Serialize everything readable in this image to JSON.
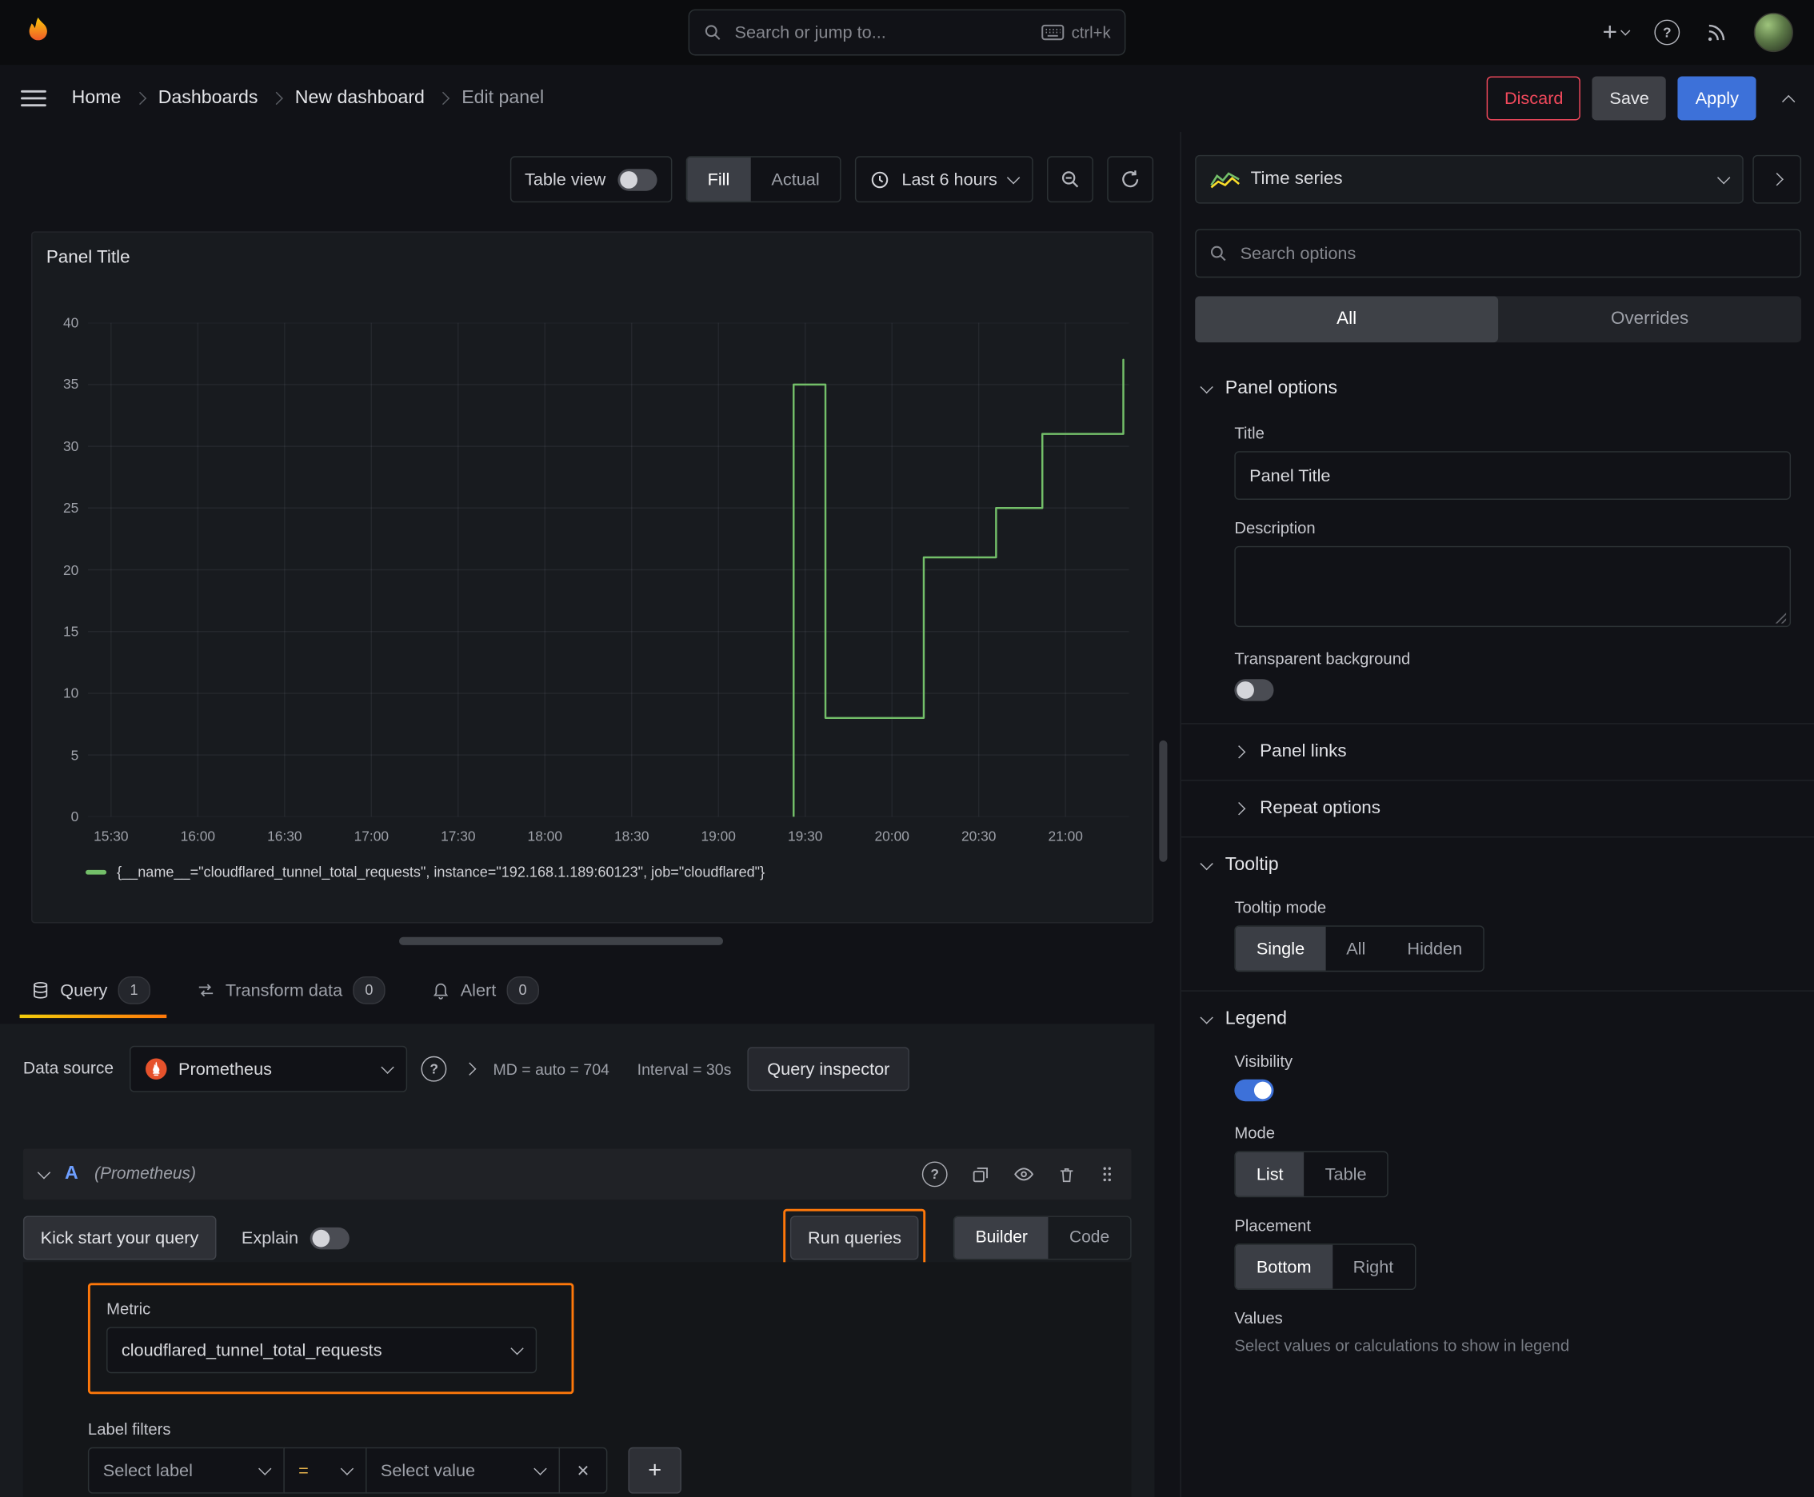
{
  "topbar": {
    "search_placeholder": "Search or jump to...",
    "search_shortcut": "ctrl+k"
  },
  "breadcrumbs": [
    "Home",
    "Dashboards",
    "New dashboard",
    "Edit panel"
  ],
  "actions": {
    "discard": "Discard",
    "save": "Save",
    "apply": "Apply"
  },
  "toolbar": {
    "table_view": "Table view",
    "fill": "Fill",
    "actual": "Actual",
    "time_range": "Last 6 hours"
  },
  "panel": {
    "title": "Panel Title"
  },
  "chart_data": {
    "type": "line",
    "line_style": "step",
    "title": "Panel Title",
    "x_ticks": [
      "15:30",
      "16:00",
      "16:30",
      "17:00",
      "17:30",
      "18:00",
      "18:30",
      "19:00",
      "19:30",
      "20:00",
      "20:30",
      "21:00"
    ],
    "y_ticks": [
      0,
      5,
      10,
      15,
      20,
      25,
      30,
      35,
      40
    ],
    "ylim": [
      0,
      40
    ],
    "x_domain": [
      "15:22",
      "21:22"
    ],
    "grid": true,
    "legend_position": "bottom",
    "series": [
      {
        "name": "{__name__=\"cloudflared_tunnel_total_requests\", instance=\"192.168.1.189:60123\", job=\"cloudflared\"}",
        "color": "#73bf69",
        "points": [
          {
            "time": "19:26",
            "value": 0
          },
          {
            "time": "19:26",
            "value": 35
          },
          {
            "time": "19:37",
            "value": 35
          },
          {
            "time": "19:37",
            "value": 8
          },
          {
            "time": "20:11",
            "value": 8
          },
          {
            "time": "20:11",
            "value": 21
          },
          {
            "time": "20:36",
            "value": 21
          },
          {
            "time": "20:36",
            "value": 25
          },
          {
            "time": "20:52",
            "value": 25
          },
          {
            "time": "20:52",
            "value": 31
          },
          {
            "time": "21:20",
            "value": 31
          },
          {
            "time": "21:20",
            "value": 37
          }
        ]
      }
    ]
  },
  "tabs": {
    "query": "Query",
    "query_badge": "1",
    "transform": "Transform data",
    "transform_badge": "0",
    "alert": "Alert",
    "alert_badge": "0"
  },
  "query": {
    "datasource_label": "Data source",
    "datasource_name": "Prometheus",
    "max_data_points": "MD = auto = 704",
    "interval": "Interval = 30s",
    "query_inspector": "Query inspector",
    "ref_id": "A",
    "ref_hint": "(Prometheus)",
    "kick_start": "Kick start your query",
    "explain": "Explain",
    "run_queries": "Run queries",
    "builder": "Builder",
    "code": "Code",
    "metric_label": "Metric",
    "metric_value": "cloudflared_tunnel_total_requests",
    "label_filters": "Label filters",
    "select_label": "Select label",
    "operator": "=",
    "select_value": "Select value"
  },
  "sidebar": {
    "viz_type": "Time series",
    "search_placeholder": "Search options",
    "tab_all": "All",
    "tab_overrides": "Overrides",
    "panel_options": {
      "header": "Panel options",
      "title_label": "Title",
      "title_value": "Panel Title",
      "description_label": "Description",
      "transparent_label": "Transparent background",
      "panel_links": "Panel links",
      "repeat_options": "Repeat options"
    },
    "tooltip": {
      "header": "Tooltip",
      "mode_label": "Tooltip mode",
      "modes": [
        "Single",
        "All",
        "Hidden"
      ],
      "selected_mode": "Single"
    },
    "legend": {
      "header": "Legend",
      "visibility_label": "Visibility",
      "mode_label": "Mode",
      "modes": [
        "List",
        "Table"
      ],
      "selected_mode": "List",
      "placement_label": "Placement",
      "placements": [
        "Bottom",
        "Right"
      ],
      "selected_placement": "Bottom",
      "values_label": "Values",
      "values_hint": "Select values or calculations to show in legend"
    }
  },
  "colors": {
    "accent_blue": "#3d71d9",
    "highlight_orange": "#ff780a",
    "series_green": "#73bf69",
    "destructive_red": "#f2495c"
  }
}
